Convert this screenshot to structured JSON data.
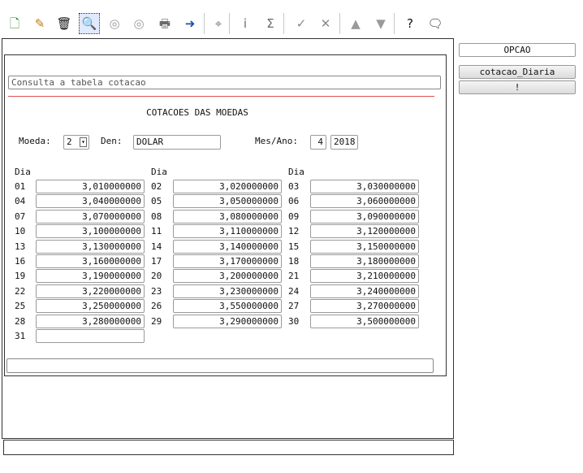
{
  "toolbar": {
    "buttons": [
      {
        "name": "new-icon",
        "glyph": "🗋",
        "color": "#2a8a2a"
      },
      {
        "name": "edit-icon",
        "glyph": "✎",
        "color": "#c07a10"
      },
      {
        "name": "delete-icon",
        "glyph": "🗑",
        "color": "#111111"
      },
      {
        "name": "search-icon",
        "glyph": "🔍",
        "color": "#1a3fa0"
      },
      {
        "name": "previous-icon",
        "glyph": "◎",
        "color": "#9a9a9a"
      },
      {
        "name": "next-icon",
        "glyph": "◎",
        "color": "#9a9a9a"
      },
      {
        "name": "print-icon",
        "glyph": "🖶",
        "color": "#6a6a6a"
      },
      {
        "name": "exit-icon",
        "glyph": "➜",
        "color": "#1a4fb0"
      },
      {
        "name": "binoculars-icon",
        "glyph": "⌖",
        "color": "#7a7a7a"
      },
      {
        "name": "info-icon",
        "glyph": "i",
        "color": "#6a6a6a"
      },
      {
        "name": "sum-icon",
        "glyph": "Σ",
        "color": "#6a6a6a"
      },
      {
        "name": "confirm-icon",
        "glyph": "✓",
        "color": "#8a8a8a"
      },
      {
        "name": "cancel-icon",
        "glyph": "✕",
        "color": "#8a8a8a"
      },
      {
        "name": "up-icon",
        "glyph": "▲",
        "color": "#9a9a9a"
      },
      {
        "name": "down-icon",
        "glyph": "▼",
        "color": "#9a9a9a"
      },
      {
        "name": "help-icon",
        "glyph": "?",
        "color": "#111111"
      },
      {
        "name": "chat-icon",
        "glyph": "🗨",
        "color": "#333333"
      }
    ]
  },
  "consulta": "Consulta a tabela cotacao",
  "form_title": "COTACOES DAS MOEDAS",
  "moeda": {
    "label": "Moeda:",
    "value": "2"
  },
  "den": {
    "label": "Den:",
    "value": "DOLAR"
  },
  "mes_ano": {
    "label": "Mes/Ano:",
    "month": "4",
    "year": "2018"
  },
  "dia_header": "Dia",
  "days": [
    {
      "day": "01",
      "value": "3,010000000"
    },
    {
      "day": "02",
      "value": "3,020000000"
    },
    {
      "day": "03",
      "value": "3,030000000"
    },
    {
      "day": "04",
      "value": "3,040000000"
    },
    {
      "day": "05",
      "value": "3,050000000"
    },
    {
      "day": "06",
      "value": "3,060000000"
    },
    {
      "day": "07",
      "value": "3,070000000"
    },
    {
      "day": "08",
      "value": "3,080000000"
    },
    {
      "day": "09",
      "value": "3,090000000"
    },
    {
      "day": "10",
      "value": "3,100000000"
    },
    {
      "day": "11",
      "value": "3,110000000"
    },
    {
      "day": "12",
      "value": "3,120000000"
    },
    {
      "day": "13",
      "value": "3,130000000"
    },
    {
      "day": "14",
      "value": "3,140000000"
    },
    {
      "day": "15",
      "value": "3,150000000"
    },
    {
      "day": "16",
      "value": "3,160000000"
    },
    {
      "day": "17",
      "value": "3,170000000"
    },
    {
      "day": "18",
      "value": "3,180000000"
    },
    {
      "day": "19",
      "value": "3,190000000"
    },
    {
      "day": "20",
      "value": "3,200000000"
    },
    {
      "day": "21",
      "value": "3,210000000"
    },
    {
      "day": "22",
      "value": "3,220000000"
    },
    {
      "day": "23",
      "value": "3,230000000"
    },
    {
      "day": "24",
      "value": "3,240000000"
    },
    {
      "day": "25",
      "value": "3,250000000"
    },
    {
      "day": "26",
      "value": "3,550000000"
    },
    {
      "day": "27",
      "value": "3,270000000"
    },
    {
      "day": "28",
      "value": "3,280000000"
    },
    {
      "day": "29",
      "value": "3,290000000"
    },
    {
      "day": "30",
      "value": "3,500000000"
    },
    {
      "day": "31",
      "value": ""
    }
  ],
  "side": {
    "opcao": "OPCAO",
    "cotacao_diaria": "cotacao_Diaria",
    "bang": "!"
  },
  "colors": {
    "accent_line": "#e05050"
  }
}
